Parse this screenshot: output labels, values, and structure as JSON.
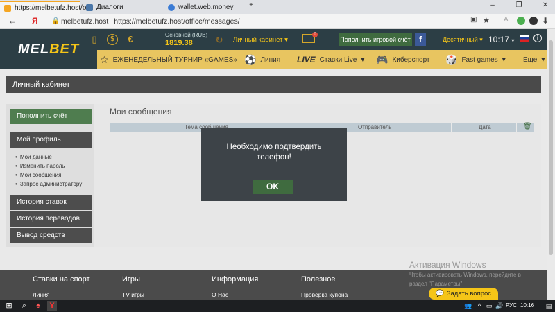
{
  "browser": {
    "tabs": [
      {
        "title": "https://melbetufz.host/of",
        "favicon_color": "#f5a623",
        "active": true
      },
      {
        "title": "Диалоги",
        "favicon_color": "#4a76a8",
        "active": false
      },
      {
        "title": "wallet.web.money",
        "favicon_color": "#3a7bd5",
        "active": false
      }
    ],
    "new_tab": "+",
    "url_host": "melbetufz.host",
    "url": "https://melbetufz.host/office/messages/",
    "yandex_glyph": "Я"
  },
  "header": {
    "logo_a": "MEL",
    "logo_b": "BET",
    "currency_glyphs": [
      "$",
      "€"
    ],
    "balance_label": "Основной (RUB)",
    "balance_value": "1819.38",
    "cabinet_link": "Личный кабинет",
    "mail_badge": "0",
    "topup_button": "Пополнить игровой счёт",
    "fb": "f",
    "odds_format": "Десятичный",
    "time": "10:17",
    "info": "i"
  },
  "nav": {
    "tournament": "ЕЖЕНЕДЕЛЬНЫЙ ТУРНИР «GAMES»",
    "line": "Линия",
    "live_tag": "LIVE",
    "live": "Ставки Live",
    "esports": "Киберспорт",
    "fastgames": "Fast games",
    "more": "Еще"
  },
  "page": {
    "title": "Личный кабинет",
    "sidebar": {
      "topup": "Пополнить счёт",
      "profile": "Мой профиль",
      "sub": [
        "Мои данные",
        "Изменить пароль",
        "Мои сообщения",
        "Запрос администратору"
      ],
      "bets_history": "История ставок",
      "transfers_history": "История переводов",
      "withdraw": "Вывод средств"
    },
    "messages": {
      "title": "Мои сообщения",
      "col_subject": "Тема сообщения",
      "col_sender": "Отправитель",
      "col_date": "Дата"
    }
  },
  "modal": {
    "line1": "Необходимо подтвердить",
    "line2": "телефон!",
    "ok": "OK"
  },
  "footer": {
    "cols": [
      {
        "head": "Ставки на спорт",
        "link": "Линия"
      },
      {
        "head": "Игры",
        "link": "TV игры"
      },
      {
        "head": "Информация",
        "link": "О Нас"
      },
      {
        "head": "Полезное",
        "link": "Проверка купона"
      }
    ],
    "ask": "Задать вопрос"
  },
  "watermark": {
    "line1": "Активация Windows",
    "line2": "Чтобы активировать Windows, перейдите в",
    "line3": "раздел \"Параметры\"."
  },
  "taskbar": {
    "lang": "РУС",
    "time": "10:16"
  },
  "colors": {
    "accent_yellow": "#e8c560",
    "brand_dark": "#2c3e45",
    "button_green": "#4f7d4f"
  }
}
